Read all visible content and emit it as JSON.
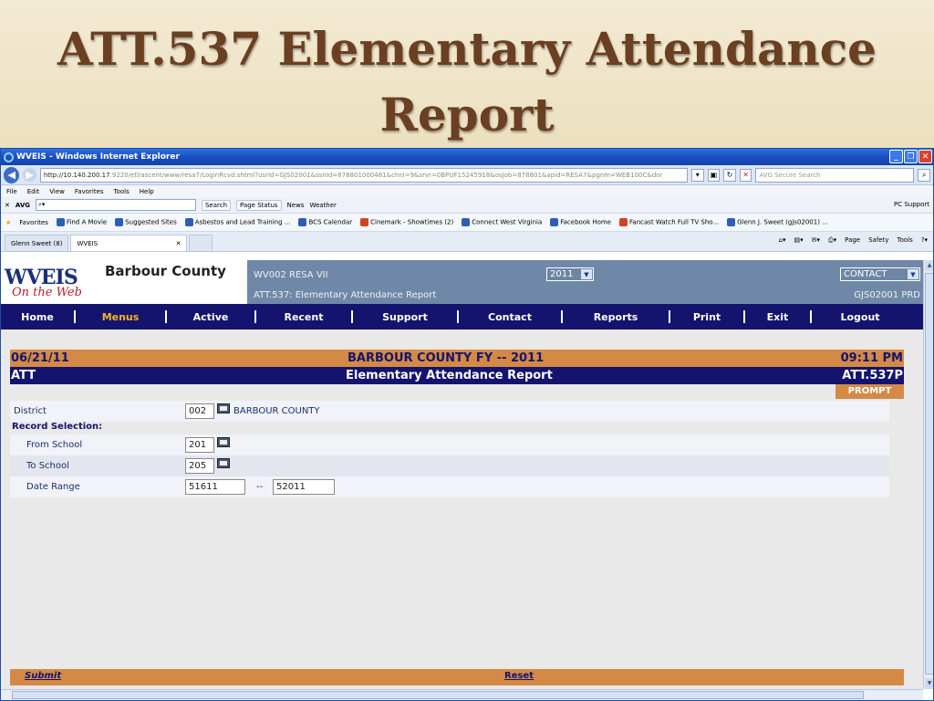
{
  "slide": {
    "title_line1": "ATT.537 Elementary Attendance",
    "title_line2": "Report"
  },
  "window": {
    "title": "WVEIS - Windows Internet Explorer"
  },
  "address": {
    "url_host": "http://10.140.200.17",
    "url_rest": ":9220/etl/ascent/www/resa7/LoginRcvd.shtml?usrId=GJS02001&ssnId=878801000481&chnl=9&srvr=0BPUF15245918&osJob=878801&apid=RESA7&pgnm=WEB100C&dor",
    "search_placeholder": "AVG Secure Search"
  },
  "menubar": [
    "File",
    "Edit",
    "View",
    "Favorites",
    "Tools",
    "Help"
  ],
  "toolbar": {
    "avg": "AVG",
    "search": "Search",
    "page_status": "Page Status",
    "news": "News",
    "weather": "Weather",
    "pc_support": "PC Support"
  },
  "favorites": {
    "label": "Favorites",
    "items": [
      "Find A Movie",
      "Suggested Sites",
      "Asbestos and Lead Training ...",
      "BCS Calendar",
      "Cinemark - Showtimes (2)",
      "Connect West Virginia",
      "Facebook Home",
      "Fancast Watch Full TV Sho...",
      "Glenn J. Sweet (gjs02001) ..."
    ]
  },
  "tabs": {
    "items": [
      "Glenn Sweet (8)",
      "WVEIS"
    ],
    "tools": [
      "Page",
      "Safety",
      "Tools"
    ]
  },
  "app": {
    "logo_main": "WVEIS",
    "logo_sub": "On the Web",
    "county": "Barbour County",
    "header_line1": "WV002 RESA VII",
    "header_line2": "ATT.537: Elementary Attendance Report",
    "year": "2011",
    "contact": "CONTACT",
    "user": "GJS02001 PRD"
  },
  "nav": [
    "Home",
    "Menus",
    "Active",
    "Recent",
    "Support",
    "Contact",
    "Reports",
    "Print",
    "Exit",
    "Logout"
  ],
  "report": {
    "date": "06/21/11",
    "heading": "BARBOUR COUNTY FY -- 2011",
    "time": "09:11 PM",
    "module": "ATT",
    "subtitle": "Elementary Attendance Report",
    "code": "ATT.537P",
    "prompt": "PROMPT"
  },
  "form": {
    "district_label": "District",
    "district_value": "002",
    "district_name": "BARBOUR COUNTY",
    "record_selection": "Record Selection:",
    "from_label": "From School",
    "from_value": "201",
    "to_label": "To School",
    "to_value": "205",
    "date_label": "Date Range",
    "date_from": "51611",
    "date_sep": "--",
    "date_to": "52011"
  },
  "footer": {
    "submit": "Submit",
    "reset": "Reset"
  }
}
